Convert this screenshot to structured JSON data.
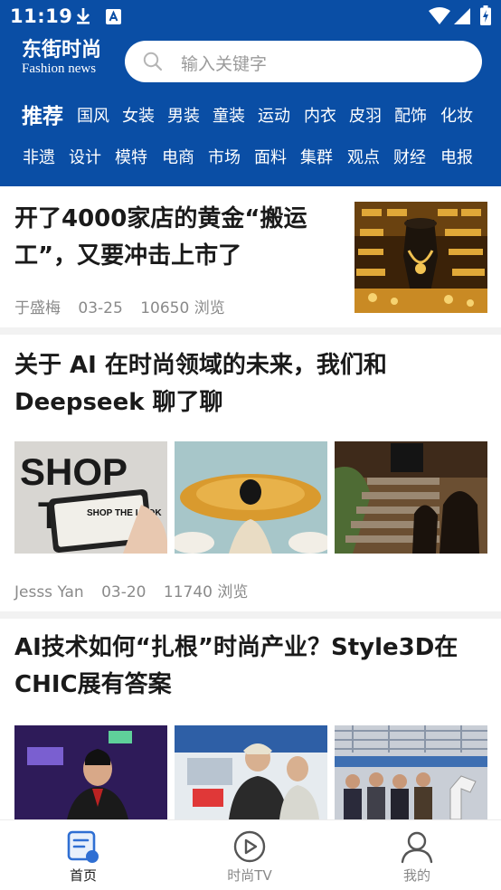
{
  "status": {
    "time": "11:19"
  },
  "brand": {
    "name_cn": "东街时尚",
    "name_en": "Fashion news"
  },
  "search": {
    "placeholder": "输入关键字"
  },
  "categories": {
    "active": "推荐",
    "row1": [
      "国风",
      "女装",
      "男装",
      "童装",
      "运动",
      "内衣",
      "皮羽",
      "配饰",
      "化妆"
    ],
    "row2": [
      "非遗",
      "设计",
      "模特",
      "电商",
      "市场",
      "面料",
      "集群",
      "观点",
      "财经",
      "电报"
    ]
  },
  "articles": [
    {
      "title_line1": "开了4000家店的黄金“搬运",
      "title_line2": "工”，又要冲击上市了",
      "author": "于盛梅",
      "date": "03-25",
      "views": "10650 浏览"
    },
    {
      "title_line1": "关于 AI 在时尚领域的未来，我们和",
      "title_line2": "Deepseek 聊了聊",
      "author": "Jesss Yan",
      "date": "03-20",
      "views": "11740 浏览",
      "thumb_text": "SHOP THE LOOK"
    },
    {
      "title_line1": "AI技术如何“扎根”时尚产业？Style3D在",
      "title_line2": "CHIC展有答案"
    }
  ],
  "tabs": [
    {
      "label": "首页",
      "icon": "news-icon",
      "active": true
    },
    {
      "label": "时尚TV",
      "icon": "play-icon",
      "active": false
    },
    {
      "label": "我的",
      "icon": "user-icon",
      "active": false
    }
  ],
  "colors": {
    "brand": "#0a4ea5",
    "tab_accent": "#2f6fd3"
  }
}
